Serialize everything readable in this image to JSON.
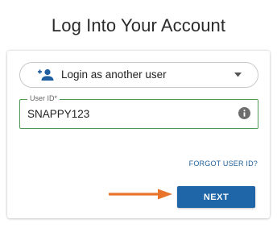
{
  "page": {
    "title": "Log Into Your Account"
  },
  "login_form": {
    "account_selector": {
      "label": "Login as another user",
      "icon": "add-user-icon"
    },
    "user_id": {
      "label": "User ID*",
      "value": "SNAPPY123",
      "info_icon": "info-icon"
    },
    "forgot_link": "FORGOT USER ID?",
    "next_label": "NEXT"
  },
  "colors": {
    "accent_blue": "#1f66a8",
    "field_border_green": "#4e9a55",
    "link_blue": "#1d5f9a",
    "annotation_arrow": "#e8742c"
  },
  "annotation": {
    "type": "arrow",
    "points_to": "next-button"
  }
}
